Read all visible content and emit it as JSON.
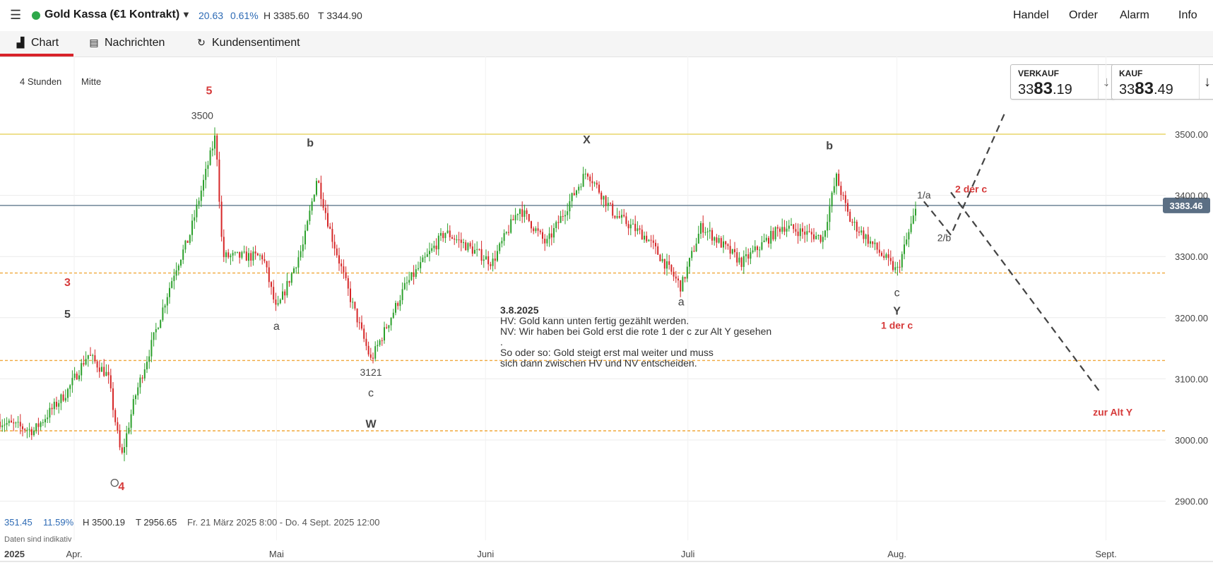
{
  "header": {
    "menu_icon": "hamburger-menu-icon",
    "status_color": "#2ea84a",
    "instrument": "Gold Kassa (€1 Kontrakt)",
    "change_abs": "20.63",
    "change_pct": "0.61%",
    "high": "H 3385.60",
    "low": "T 3344.90",
    "nav": [
      "Handel",
      "Order",
      "Alarm",
      "Info"
    ]
  },
  "tabs": [
    {
      "label": "Chart",
      "icon": "chart-bars-icon",
      "active": true
    },
    {
      "label": "Nachrichten",
      "icon": "newspaper-icon",
      "active": false
    },
    {
      "label": "Kundensentiment",
      "icon": "sentiment-circle-icon",
      "active": false
    }
  ],
  "chips": {
    "interval": "4 Stunden",
    "price_type": "Mitte"
  },
  "quotes": {
    "sell": {
      "label": "VERKAUF",
      "prefix": "33",
      "big": "83",
      "decimals": ".19"
    },
    "buy": {
      "label": "KAUF",
      "prefix": "33",
      "big": "83",
      "decimals": ".49"
    }
  },
  "colors": {
    "up": "#2ca02c",
    "down": "#d62728",
    "accent_red": "#d8232a",
    "wave_red": "#d63a3a",
    "resistance": "#e8d66a",
    "support": "#f0a83c",
    "current_line": "#6e8596"
  },
  "stats": {
    "change": "351.45",
    "change_pct": "11.59%",
    "high": "H 3500.19",
    "low": "T 2956.65",
    "range": "Fr. 21 März 2025 8:00 - Do. 4 Sept. 2025 12:00",
    "note": "Daten sind indikativ"
  },
  "chart_data": {
    "type": "candlestick",
    "instrument": "Gold Kassa (€1 Kontrakt)",
    "interval": "4 Stunden",
    "ylim": [
      2850,
      3560
    ],
    "y_ticks": [
      "3500.00",
      "3400.00",
      "3300.00",
      "3200.00",
      "3100.00",
      "3000.00",
      "2900.00"
    ],
    "x_ticks": [
      "2025",
      "Apr.",
      "Mai",
      "Juni",
      "Juli",
      "Aug.",
      "Sept."
    ],
    "current_price": "3383.46",
    "horizontal_lines": [
      {
        "kind": "resistance",
        "value": 3500
      },
      {
        "kind": "current",
        "value": 3383.46
      },
      {
        "kind": "support",
        "value": 3273
      },
      {
        "kind": "support",
        "value": 3130
      },
      {
        "kind": "support",
        "value": 3015
      }
    ],
    "series": [
      {
        "points": [
          {
            "date": "2025-03-21",
            "close": 3030
          },
          {
            "date": "2025-03-26",
            "close": 3015
          },
          {
            "date": "2025-03-31",
            "close": 3080
          },
          {
            "date": "2025-04-03",
            "close": 3140
          },
          {
            "date": "2025-04-06",
            "close": 3105
          },
          {
            "date": "2025-04-08",
            "close": 2970
          },
          {
            "date": "2025-04-10",
            "close": 3070
          },
          {
            "date": "2025-04-16",
            "close": 3280
          },
          {
            "date": "2025-04-18",
            "close": 3330
          },
          {
            "date": "2025-04-22",
            "close": 3500
          },
          {
            "date": "2025-04-23",
            "close": 3300
          },
          {
            "date": "2025-04-29",
            "close": 3300
          },
          {
            "date": "2025-05-01",
            "close": 3210
          },
          {
            "date": "2025-05-05",
            "close": 3320
          },
          {
            "date": "2025-05-07",
            "close": 3430
          },
          {
            "date": "2025-05-09",
            "close": 3340
          },
          {
            "date": "2025-05-12",
            "close": 3230
          },
          {
            "date": "2025-05-15",
            "close": 3130
          },
          {
            "date": "2025-05-20",
            "close": 3250
          },
          {
            "date": "2025-05-26",
            "close": 3340
          },
          {
            "date": "2025-06-02",
            "close": 3290
          },
          {
            "date": "2025-06-06",
            "close": 3380
          },
          {
            "date": "2025-06-10",
            "close": 3320
          },
          {
            "date": "2025-06-16",
            "close": 3440
          },
          {
            "date": "2025-06-20",
            "close": 3370
          },
          {
            "date": "2025-06-25",
            "close": 3330
          },
          {
            "date": "2025-06-30",
            "close": 3250
          },
          {
            "date": "2025-07-03",
            "close": 3350
          },
          {
            "date": "2025-07-09",
            "close": 3290
          },
          {
            "date": "2025-07-15",
            "close": 3350
          },
          {
            "date": "2025-07-21",
            "close": 3330
          },
          {
            "date": "2025-07-23",
            "close": 3430
          },
          {
            "date": "2025-07-25",
            "close": 3360
          },
          {
            "date": "2025-07-30",
            "close": 3300
          },
          {
            "date": "2025-08-01",
            "close": 3275
          },
          {
            "date": "2025-08-04",
            "close": 3383
          }
        ]
      }
    ],
    "projections": [
      {
        "points": [
          [
            "2025-08-05",
            3390
          ],
          [
            "2025-08-09",
            3335
          ],
          [
            "2025-08-17",
            3535
          ]
        ]
      },
      {
        "points": [
          [
            "2025-08-09",
            3405
          ],
          [
            "2025-08-31",
            3080
          ]
        ]
      }
    ],
    "annotations": [
      {
        "text": "5",
        "date": "2025-04-21",
        "value": 3565,
        "color": "red"
      },
      {
        "text": "3500",
        "date": "2025-04-20",
        "value": 3525
      },
      {
        "text": "b",
        "date": "2025-05-06",
        "value": 3480
      },
      {
        "text": "X",
        "date": "2025-06-16",
        "value": 3485
      },
      {
        "text": "b",
        "date": "2025-07-22",
        "value": 3475
      },
      {
        "text": "1/a",
        "date": "2025-08-05",
        "value": 3395
      },
      {
        "text": "2 der c",
        "date": "2025-08-12",
        "value": 3405,
        "color": "red"
      },
      {
        "text": "2/b",
        "date": "2025-08-08",
        "value": 3325
      },
      {
        "text": "3",
        "date": "2025-03-31",
        "value": 3252,
        "color": "red"
      },
      {
        "text": "5",
        "date": "2025-03-31",
        "value": 3200
      },
      {
        "text": "a",
        "date": "2025-05-01",
        "value": 3180
      },
      {
        "text": "a",
        "date": "2025-06-30",
        "value": 3220
      },
      {
        "text": "c",
        "date": "2025-08-01",
        "value": 3235
      },
      {
        "text": "Y",
        "date": "2025-08-01",
        "value": 3205
      },
      {
        "text": "1 der c",
        "date": "2025-08-01",
        "value": 3182,
        "color": "red"
      },
      {
        "text": "3121",
        "date": "2025-05-15",
        "value": 3105
      },
      {
        "text": "c",
        "date": "2025-05-15",
        "value": 3071
      },
      {
        "text": "W",
        "date": "2025-05-15",
        "value": 3020
      },
      {
        "text": "zur Alt Y",
        "date": "2025-09-02",
        "value": 3040,
        "color": "red"
      },
      {
        "text": "4",
        "date": "2025-04-08",
        "value": 2918,
        "color": "red"
      }
    ],
    "note_lines": [
      "3.8.2025",
      "HV: Gold kann unten fertig gezählt werden.",
      "NV: Wir haben bei Gold erst die rote 1 der c zur Alt Y gesehen",
      ".",
      "So oder so: Gold steigt erst mal weiter und muss",
      "sich dann zwischen HV und NV entscheiden."
    ]
  }
}
